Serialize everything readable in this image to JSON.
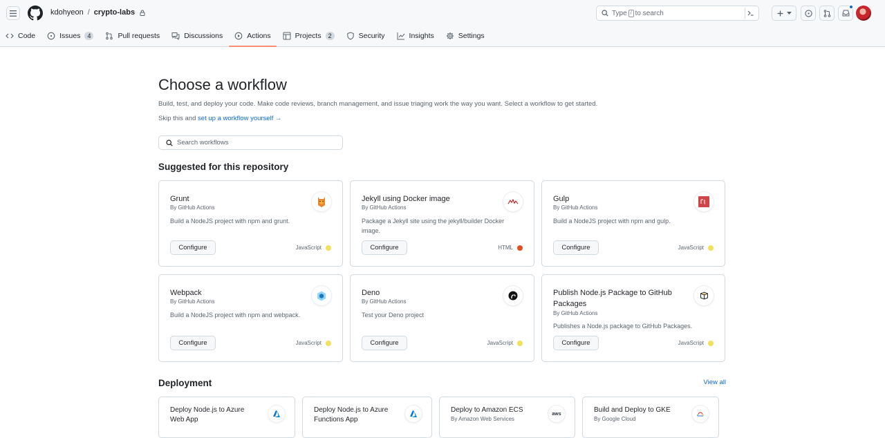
{
  "header": {
    "owner": "kdohyeon",
    "separator": "/",
    "repo": "crypto-labs",
    "search_prefix": "Type",
    "search_key": "/",
    "search_suffix": "to search"
  },
  "tabs": [
    {
      "label": "Code",
      "icon": "code-icon"
    },
    {
      "label": "Issues",
      "count": "4",
      "icon": "issue-icon"
    },
    {
      "label": "Pull requests",
      "icon": "pull-request-icon"
    },
    {
      "label": "Discussions",
      "icon": "discussion-icon"
    },
    {
      "label": "Actions",
      "icon": "play-icon",
      "active": true
    },
    {
      "label": "Projects",
      "count": "2",
      "icon": "table-icon"
    },
    {
      "label": "Security",
      "icon": "shield-icon"
    },
    {
      "label": "Insights",
      "icon": "graph-icon"
    },
    {
      "label": "Settings",
      "icon": "gear-icon"
    }
  ],
  "page": {
    "title": "Choose a workflow",
    "subtitle": "Build, test, and deploy your code. Make code reviews, branch management, and issue triaging work the way you want. Select a workflow to get started.",
    "skip_prefix": "Skip this and",
    "skip_link": "set up a workflow yourself →",
    "search_placeholder": "Search workflows"
  },
  "suggested": {
    "title": "Suggested for this repository",
    "cards": [
      {
        "name": "Grunt",
        "by": "By GitHub Actions",
        "desc": "Build a NodeJS project with npm and grunt.",
        "button": "Configure",
        "lang": "JavaScript",
        "lang_color": "#f1e05a",
        "logo": "grunt-logo"
      },
      {
        "name": "Jekyll using Docker image",
        "by": "By GitHub Actions",
        "desc": "Package a Jekyll site using the jekyll/builder Docker image.",
        "button": "Configure",
        "lang": "HTML",
        "lang_color": "#e34c26",
        "logo": "jekyll-logo"
      },
      {
        "name": "Gulp",
        "by": "By GitHub Actions",
        "desc": "Build a NodeJS project with npm and gulp.",
        "button": "Configure",
        "lang": "JavaScript",
        "lang_color": "#f1e05a",
        "logo": "gulp-logo"
      },
      {
        "name": "Webpack",
        "by": "By GitHub Actions",
        "desc": "Build a NodeJS project with npm and webpack.",
        "button": "Configure",
        "lang": "JavaScript",
        "lang_color": "#f1e05a",
        "logo": "webpack-logo"
      },
      {
        "name": "Deno",
        "by": "By GitHub Actions",
        "desc": "Test your Deno project",
        "button": "Configure",
        "lang": "JavaScript",
        "lang_color": "#f1e05a",
        "logo": "deno-logo"
      },
      {
        "name": "Publish Node.js Package to GitHub Packages",
        "by": "By GitHub Actions",
        "desc": "Publishes a Node.js package to GitHub Packages.",
        "button": "Configure",
        "lang": "JavaScript",
        "lang_color": "#f1e05a",
        "logo": "package-logo"
      }
    ]
  },
  "deployment": {
    "title": "Deployment",
    "view_all": "View all",
    "cards": [
      {
        "name": "Deploy Node.js to Azure Web App",
        "by": "",
        "logo": "azure-logo"
      },
      {
        "name": "Deploy Node.js to Azure Functions App",
        "by": "",
        "logo": "azure-logo"
      },
      {
        "name": "Deploy to Amazon ECS",
        "by": "By Amazon Web Services",
        "logo": "aws-logo",
        "logo_text": "aws"
      },
      {
        "name": "Build and Deploy to GKE",
        "by": "By Google Cloud",
        "logo": "gke-logo"
      }
    ]
  },
  "colors": {
    "accent": "#0969da",
    "active_tab_underline": "#fd8c73"
  }
}
